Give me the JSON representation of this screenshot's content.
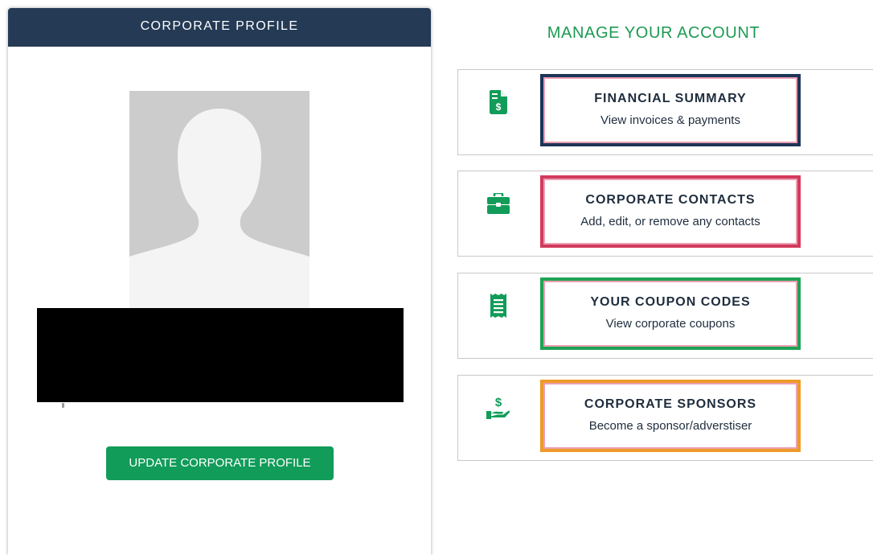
{
  "profile": {
    "header": "CORPORATE PROFILE",
    "update_button": "UPDATE CORPORATE PROFILE"
  },
  "manage": {
    "heading": "MANAGE YOUR ACCOUNT",
    "cards": [
      {
        "title": "FINANCIAL SUMMARY",
        "description": "View invoices & payments",
        "icon": "invoice-dollar-icon",
        "highlight_color": "#1d3557"
      },
      {
        "title": "CORPORATE CONTACTS",
        "description": "Add, edit, or remove any contacts",
        "icon": "briefcase-icon",
        "highlight_color": "#d23a5c"
      },
      {
        "title": "YOUR COUPON CODES",
        "description": "View corporate coupons",
        "icon": "receipt-icon",
        "highlight_color": "#1ea355"
      },
      {
        "title": "CORPORATE SPONSORS",
        "description": "Become a sponsor/adverstiser",
        "icon": "hand-dollar-icon",
        "highlight_color": "#ee9a28"
      }
    ]
  },
  "colors": {
    "header_bg": "#243a55",
    "accent_green": "#119c59",
    "heading_green": "#1d9a52",
    "text_dark": "#1f2d3d",
    "inner_border_pink": "#ec9fb3"
  }
}
